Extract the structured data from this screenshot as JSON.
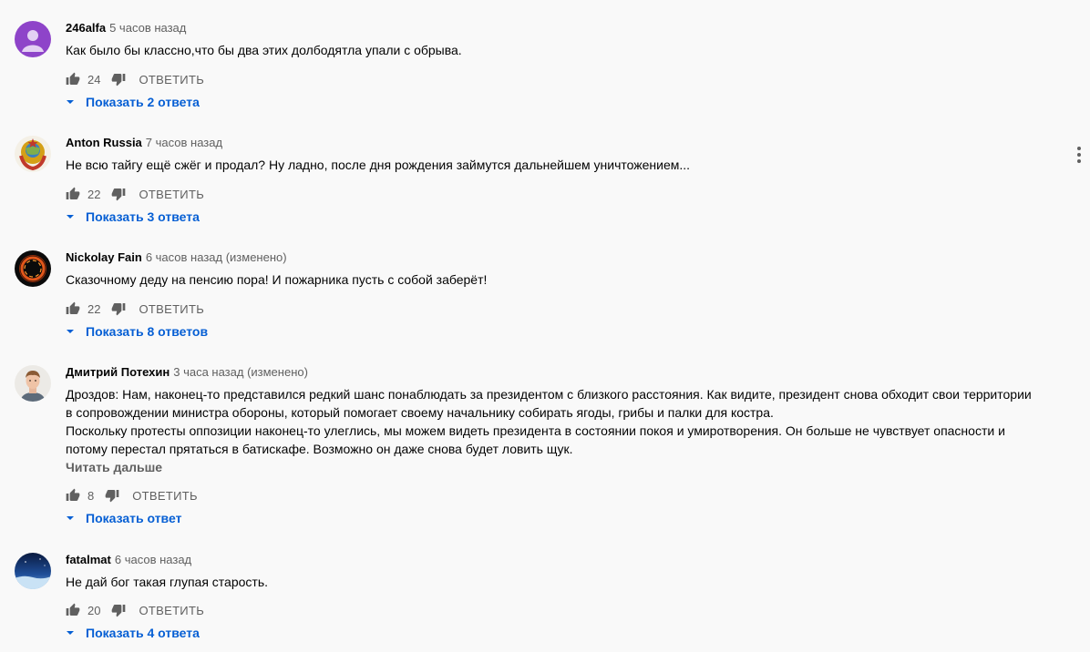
{
  "comments": [
    {
      "author": "246alfa",
      "time": "5 часов назад",
      "text": "Как было бы классно,что бы два этих долбодятла упали с обрыва.",
      "likes": "24",
      "reply_label": "ОТВЕТИТЬ",
      "replies_label": "Показать 2 ответа"
    },
    {
      "author": "Anton Russia",
      "time": "7 часов назад",
      "text": "Не всю тайгу ещё сжёг и продал? Ну ладно, после дня рождения займутся дальнейшем уничтожением...",
      "likes": "22",
      "reply_label": "ОТВЕТИТЬ",
      "replies_label": "Показать 3 ответа"
    },
    {
      "author": "Nickolay Fain",
      "time": "6 часов назад (изменено)",
      "text": "Сказочному деду на пенсию пора! И пожарника пусть с собой заберёт!",
      "likes": "22",
      "reply_label": "ОТВЕТИТЬ",
      "replies_label": "Показать 8 ответов"
    },
    {
      "author": "Дмитрий Потехин",
      "time": "3 часа назад (изменено)",
      "text_lines": [
        "Дроздов: Нам, наконец-то представился редкий шанс понаблюдать за президентом с близкого расстояния. Как видите, президент снова обходит свои территории",
        "в сопровождении министра обороны, который помогает своему начальнику собирать ягоды, грибы и палки для костра.",
        "Поскольку протесты оппозиции наконец-то улеглись, мы можем видеть президента в состоянии покоя и умиротворения. Он больше не чувствует опасности и",
        "потому перестал прятаться в батискафе. Возможно он даже снова будет ловить щук."
      ],
      "read_more": "Читать дальше",
      "likes": "8",
      "reply_label": "ОТВЕТИТЬ",
      "replies_label": "Показать ответ"
    },
    {
      "author": "fatalmat",
      "time": "6 часов назад",
      "text": "Не дай бог такая глупая старость.",
      "likes": "20",
      "reply_label": "ОТВЕТИТЬ",
      "replies_label": "Показать 4 ответа"
    }
  ],
  "colors": {
    "background": "#f9f9f9",
    "link_blue": "#065fd4",
    "secondary_text": "#606060"
  },
  "icons": [
    "like-icon",
    "dislike-icon",
    "chevron-down-icon",
    "more-vert-icon"
  ]
}
